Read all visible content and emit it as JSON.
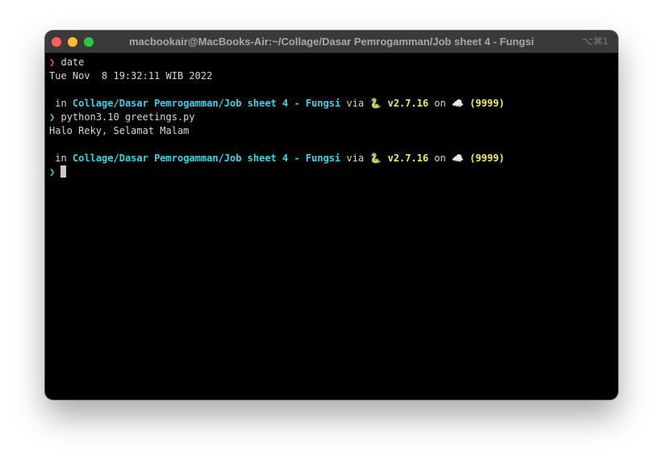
{
  "window": {
    "title": "macbookair@MacBooks-Air:~/Collage/Dasar Pemrogamman/Job sheet 4 - Fungsi",
    "shortcut": "⌥⌘1"
  },
  "terminal": {
    "prompt_symbol": "❯",
    "line1_cmd": "date",
    "line2_output": "Tue Nov  8 19:32:11 WIB 2022",
    "status1": {
      "in_label": "in",
      "path": "Collage/Dasar Pemrogamman/Job sheet 4 - Fungsi",
      "via_label": "via",
      "python_icon": "🐍",
      "version": "v2.7.16",
      "on_label": "on",
      "cloud_icon": "☁️",
      "session": "(9999)"
    },
    "line4_cmd": "python3.10 greetings.py",
    "line5_output": "Halo Reky, Selamat Malam",
    "status2": {
      "in_label": "in",
      "path": "Collage/Dasar Pemrogamman/Job sheet 4 - Fungsi",
      "via_label": "via",
      "python_icon": "🐍",
      "version": "v2.7.16",
      "on_label": "on",
      "cloud_icon": "☁️",
      "session": "(9999)"
    }
  },
  "colors": {
    "prompt_error": "#ff4d4d",
    "prompt_ok": "#3ee65c",
    "path": "#35d6e8",
    "version": "#f2f24a"
  }
}
